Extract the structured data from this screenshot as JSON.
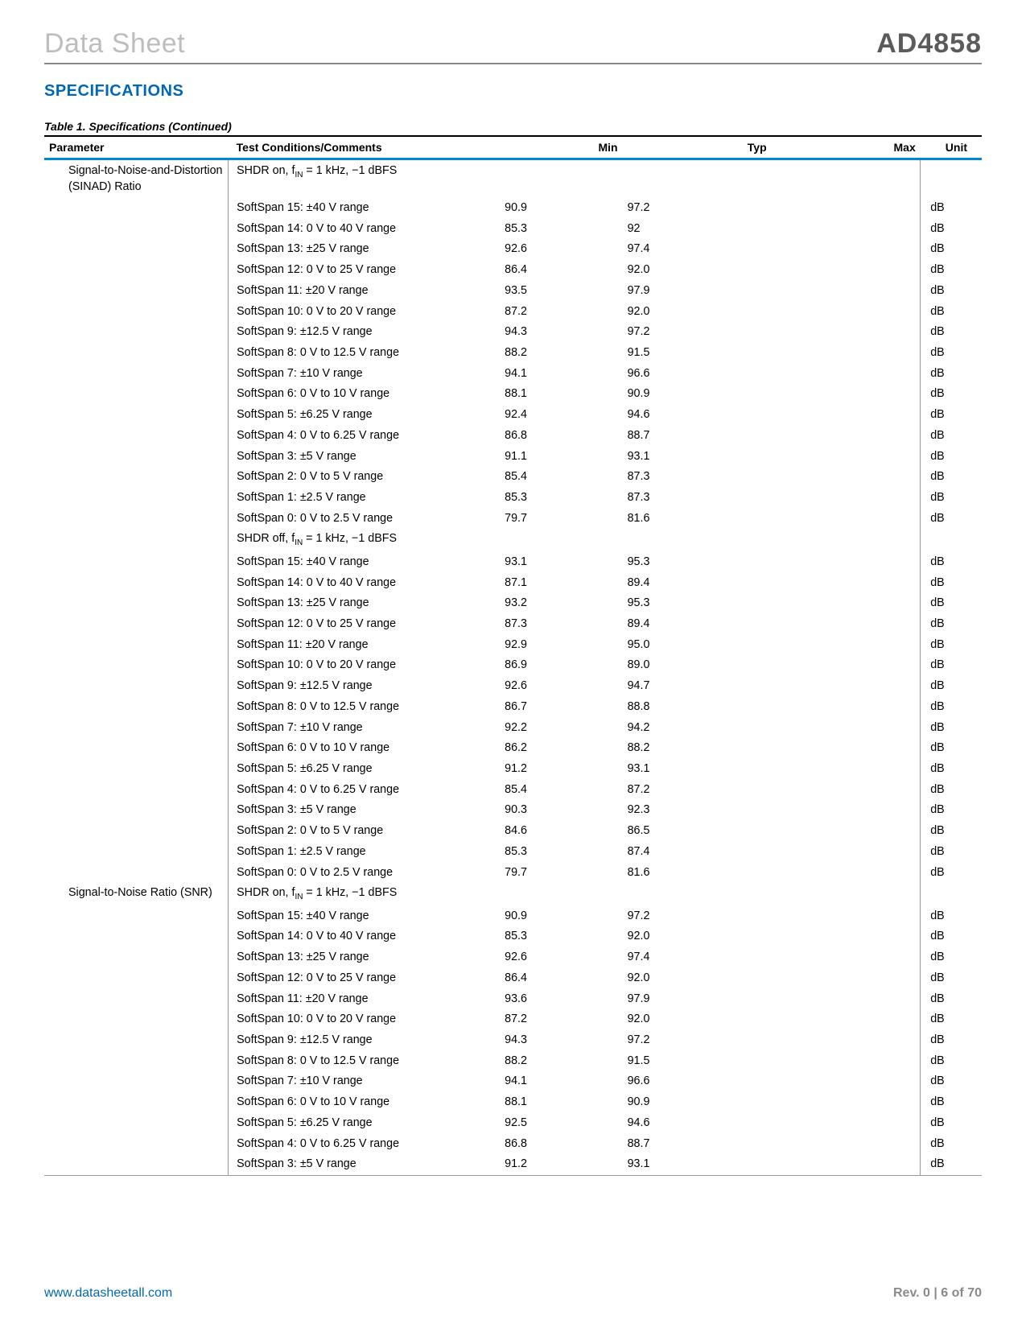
{
  "header": {
    "left": "Data Sheet",
    "right": "AD4858"
  },
  "section_title": "SPECIFICATIONS",
  "table_caption": "Table 1. Specifications (Continued)",
  "columns": {
    "parameter": "Parameter",
    "cond": "Test Conditions/Comments",
    "min": "Min",
    "typ": "Typ",
    "max": "Max",
    "unit": "Unit"
  },
  "rows": [
    {
      "param": "Signal-to-Noise-and-Distortion (SINAD) Ratio",
      "cond_html": "SHDR on, f<sub>IN</sub> = 1 kHz, −1 dBFS",
      "min": "",
      "typ": "",
      "max": "",
      "unit": ""
    },
    {
      "param": "",
      "cond": "SoftSpan 15: ±40 V range",
      "min": "90.9",
      "typ": "97.2",
      "max": "",
      "unit": "dB"
    },
    {
      "param": "",
      "cond": "SoftSpan 14: 0 V to 40 V range",
      "min": "85.3",
      "typ": "92",
      "max": "",
      "unit": "dB"
    },
    {
      "param": "",
      "cond": "SoftSpan 13: ±25 V range",
      "min": "92.6",
      "typ": "97.4",
      "max": "",
      "unit": "dB"
    },
    {
      "param": "",
      "cond": "SoftSpan 12: 0 V to 25 V range",
      "min": "86.4",
      "typ": "92.0",
      "max": "",
      "unit": "dB"
    },
    {
      "param": "",
      "cond": "SoftSpan 11: ±20 V range",
      "min": "93.5",
      "typ": "97.9",
      "max": "",
      "unit": "dB"
    },
    {
      "param": "",
      "cond": "SoftSpan 10: 0 V to 20 V range",
      "min": "87.2",
      "typ": "92.0",
      "max": "",
      "unit": "dB"
    },
    {
      "param": "",
      "cond": "SoftSpan 9: ±12.5 V range",
      "min": "94.3",
      "typ": "97.2",
      "max": "",
      "unit": "dB"
    },
    {
      "param": "",
      "cond": "SoftSpan 8: 0 V to 12.5 V range",
      "min": "88.2",
      "typ": "91.5",
      "max": "",
      "unit": "dB"
    },
    {
      "param": "",
      "cond": "SoftSpan 7: ±10 V range",
      "min": "94.1",
      "typ": "96.6",
      "max": "",
      "unit": "dB"
    },
    {
      "param": "",
      "cond": "SoftSpan 6: 0 V to 10 V range",
      "min": "88.1",
      "typ": "90.9",
      "max": "",
      "unit": "dB"
    },
    {
      "param": "",
      "cond": "SoftSpan 5: ±6.25 V range",
      "min": "92.4",
      "typ": "94.6",
      "max": "",
      "unit": "dB"
    },
    {
      "param": "",
      "cond": "SoftSpan 4: 0 V to 6.25 V range",
      "min": "86.8",
      "typ": "88.7",
      "max": "",
      "unit": "dB"
    },
    {
      "param": "",
      "cond": "SoftSpan 3: ±5 V range",
      "min": "91.1",
      "typ": "93.1",
      "max": "",
      "unit": "dB"
    },
    {
      "param": "",
      "cond": "SoftSpan 2: 0 V to 5 V range",
      "min": "85.4",
      "typ": "87.3",
      "max": "",
      "unit": "dB"
    },
    {
      "param": "",
      "cond": "SoftSpan 1: ±2.5 V range",
      "min": "85.3",
      "typ": "87.3",
      "max": "",
      "unit": "dB"
    },
    {
      "param": "",
      "cond": "SoftSpan 0: 0 V to 2.5 V range",
      "min": "79.7",
      "typ": "81.6",
      "max": "",
      "unit": "dB"
    },
    {
      "param": "",
      "cond_html": "SHDR off, f<sub>IN</sub> = 1 kHz, −1 dBFS",
      "min": "",
      "typ": "",
      "max": "",
      "unit": ""
    },
    {
      "param": "",
      "cond": "SoftSpan 15: ±40 V range",
      "min": "93.1",
      "typ": "95.3",
      "max": "",
      "unit": "dB"
    },
    {
      "param": "",
      "cond": "SoftSpan 14: 0 V to 40 V range",
      "min": "87.1",
      "typ": "89.4",
      "max": "",
      "unit": "dB"
    },
    {
      "param": "",
      "cond": "SoftSpan 13: ±25 V range",
      "min": "93.2",
      "typ": "95.3",
      "max": "",
      "unit": "dB"
    },
    {
      "param": "",
      "cond": "SoftSpan 12: 0 V to 25 V range",
      "min": "87.3",
      "typ": "89.4",
      "max": "",
      "unit": "dB"
    },
    {
      "param": "",
      "cond": "SoftSpan 11: ±20 V range",
      "min": "92.9",
      "typ": "95.0",
      "max": "",
      "unit": "dB"
    },
    {
      "param": "",
      "cond": "SoftSpan 10: 0 V to 20 V range",
      "min": "86.9",
      "typ": "89.0",
      "max": "",
      "unit": "dB"
    },
    {
      "param": "",
      "cond": "SoftSpan 9: ±12.5 V range",
      "min": "92.6",
      "typ": "94.7",
      "max": "",
      "unit": "dB"
    },
    {
      "param": "",
      "cond": "SoftSpan 8: 0 V to 12.5 V range",
      "min": "86.7",
      "typ": "88.8",
      "max": "",
      "unit": "dB"
    },
    {
      "param": "",
      "cond": "SoftSpan 7: ±10 V range",
      "min": "92.2",
      "typ": "94.2",
      "max": "",
      "unit": "dB"
    },
    {
      "param": "",
      "cond": "SoftSpan 6: 0 V to 10 V range",
      "min": "86.2",
      "typ": "88.2",
      "max": "",
      "unit": "dB"
    },
    {
      "param": "",
      "cond": "SoftSpan 5: ±6.25 V range",
      "min": "91.2",
      "typ": "93.1",
      "max": "",
      "unit": "dB"
    },
    {
      "param": "",
      "cond": "SoftSpan 4: 0 V to 6.25 V range",
      "min": "85.4",
      "typ": "87.2",
      "max": "",
      "unit": "dB"
    },
    {
      "param": "",
      "cond": "SoftSpan 3: ±5 V range",
      "min": "90.3",
      "typ": "92.3",
      "max": "",
      "unit": "dB"
    },
    {
      "param": "",
      "cond": "SoftSpan 2: 0 V to 5 V range",
      "min": "84.6",
      "typ": "86.5",
      "max": "",
      "unit": "dB"
    },
    {
      "param": "",
      "cond": "SoftSpan 1: ±2.5 V range",
      "min": "85.3",
      "typ": "87.4",
      "max": "",
      "unit": "dB"
    },
    {
      "param": "",
      "cond": "SoftSpan 0: 0 V to 2.5 V range",
      "min": "79.7",
      "typ": "81.6",
      "max": "",
      "unit": "dB"
    },
    {
      "param": "Signal-to-Noise Ratio (SNR)",
      "cond_html": "SHDR on, f<sub>IN</sub> = 1 kHz, −1 dBFS",
      "min": "",
      "typ": "",
      "max": "",
      "unit": ""
    },
    {
      "param": "",
      "cond": "SoftSpan 15: ±40 V range",
      "min": "90.9",
      "typ": "97.2",
      "max": "",
      "unit": "dB"
    },
    {
      "param": "",
      "cond": "SoftSpan 14: 0 V to 40 V range",
      "min": "85.3",
      "typ": "92.0",
      "max": "",
      "unit": "dB"
    },
    {
      "param": "",
      "cond": "SoftSpan 13: ±25 V range",
      "min": "92.6",
      "typ": "97.4",
      "max": "",
      "unit": "dB"
    },
    {
      "param": "",
      "cond": "SoftSpan 12: 0 V to 25 V range",
      "min": "86.4",
      "typ": "92.0",
      "max": "",
      "unit": "dB"
    },
    {
      "param": "",
      "cond": "SoftSpan 11: ±20 V range",
      "min": "93.6",
      "typ": "97.9",
      "max": "",
      "unit": "dB"
    },
    {
      "param": "",
      "cond": "SoftSpan 10: 0 V to 20 V range",
      "min": "87.2",
      "typ": "92.0",
      "max": "",
      "unit": "dB"
    },
    {
      "param": "",
      "cond": "SoftSpan 9: ±12.5 V range",
      "min": "94.3",
      "typ": "97.2",
      "max": "",
      "unit": "dB"
    },
    {
      "param": "",
      "cond": "SoftSpan 8: 0 V to 12.5 V range",
      "min": "88.2",
      "typ": "91.5",
      "max": "",
      "unit": "dB"
    },
    {
      "param": "",
      "cond": "SoftSpan 7: ±10 V range",
      "min": "94.1",
      "typ": "96.6",
      "max": "",
      "unit": "dB"
    },
    {
      "param": "",
      "cond": "SoftSpan 6: 0 V to 10 V range",
      "min": "88.1",
      "typ": "90.9",
      "max": "",
      "unit": "dB"
    },
    {
      "param": "",
      "cond": "SoftSpan 5: ±6.25 V range",
      "min": "92.5",
      "typ": "94.6",
      "max": "",
      "unit": "dB"
    },
    {
      "param": "",
      "cond": "SoftSpan 4: 0 V to 6.25 V range",
      "min": "86.8",
      "typ": "88.7",
      "max": "",
      "unit": "dB"
    },
    {
      "param": "",
      "cond": "SoftSpan 3: ±5 V range",
      "min": "91.2",
      "typ": "93.1",
      "max": "",
      "unit": "dB"
    }
  ],
  "footer": {
    "link_text": "www.datasheetall.com",
    "rev": "Rev. 0 | 6 of 70"
  }
}
